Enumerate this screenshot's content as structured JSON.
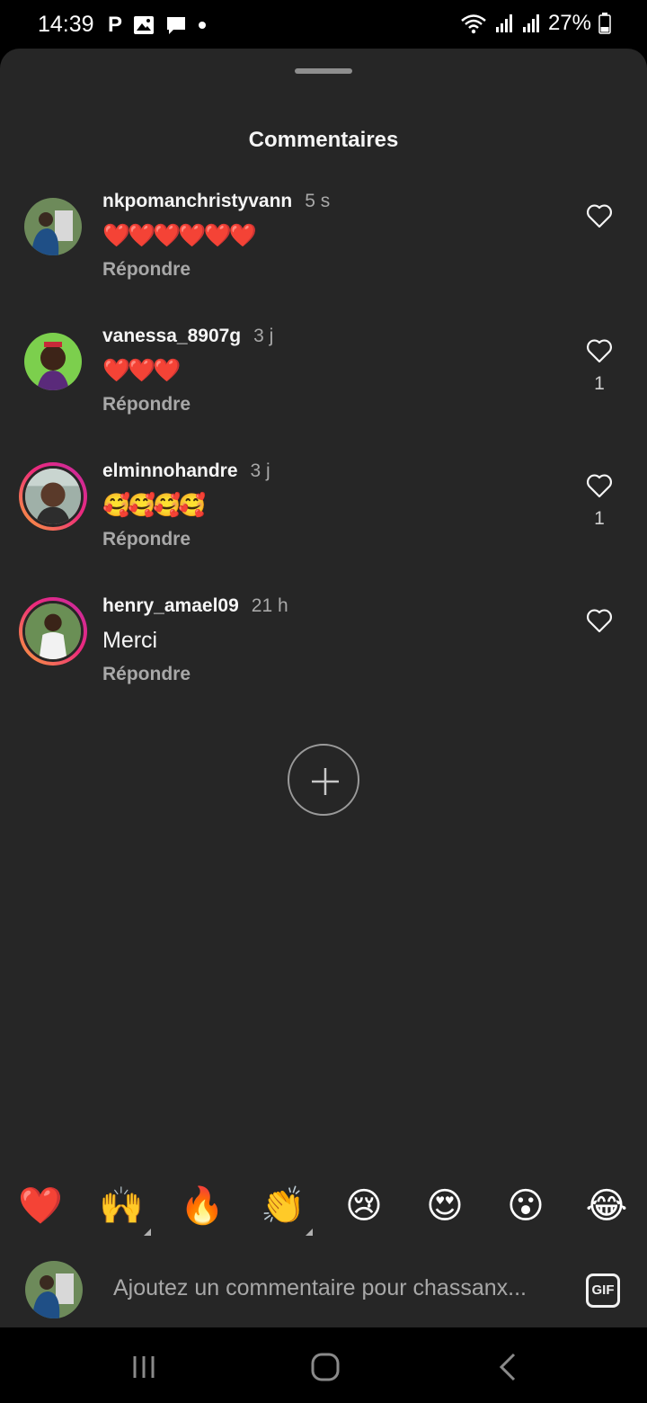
{
  "status_bar": {
    "time": "14:39",
    "battery": "27%",
    "icons": [
      "parking-p-icon",
      "gallery-icon",
      "message-icon",
      "dot-icon",
      "wifi-icon",
      "signal-icon",
      "signal-icon",
      "battery-icon"
    ]
  },
  "sheet": {
    "title": "Commentaires"
  },
  "comments": [
    {
      "username": "nkpomanchristyvann",
      "time": "5 s",
      "text": "❤️❤️❤️❤️❤️❤️",
      "reply": "Répondre",
      "likes": "",
      "story_ring": false
    },
    {
      "username": "vanessa_8907g",
      "time": "3 j",
      "text": "❤️❤️❤️",
      "reply": "Répondre",
      "likes": "1",
      "story_ring": false
    },
    {
      "username": "elminnohandre",
      "time": "3 j",
      "text": "🥰🥰🥰🥰",
      "reply": "Répondre",
      "likes": "1",
      "story_ring": true
    },
    {
      "username": "henry_amael09",
      "time": "21 h",
      "text": "Merci",
      "reply": "Répondre",
      "likes": "",
      "story_ring": true
    }
  ],
  "quick_reactions": [
    "❤️",
    "🙌",
    "🔥",
    "👏",
    "😢",
    "😍",
    "😮",
    "😂"
  ],
  "composer": {
    "placeholder": "Ajoutez un commentaire pour chassanx...",
    "gif_label": "GIF"
  },
  "colors": {
    "sheet_bg": "#262626",
    "secondary_text": "#a8a8a8",
    "story_ring_start": "#f9a33a",
    "story_ring_end": "#c32aa3"
  }
}
